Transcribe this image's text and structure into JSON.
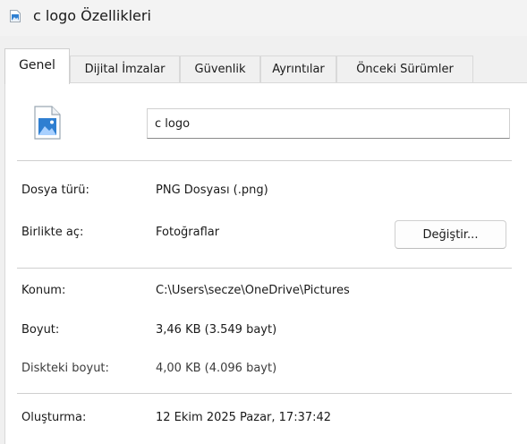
{
  "window": {
    "title": "c logo Özellikleri",
    "icon": "image-file-icon"
  },
  "tabs": [
    {
      "label": "Genel",
      "active": true
    },
    {
      "label": "Dijital İmzalar",
      "active": false
    },
    {
      "label": "Güvenlik",
      "active": false
    },
    {
      "label": "Ayrıntılar",
      "active": false
    },
    {
      "label": "Önceki Sürümler",
      "active": false
    }
  ],
  "general": {
    "file_icon": "png-image-icon",
    "file_name": "c logo",
    "type_label": "Dosya türü:",
    "type_value": "PNG Dosyası (.png)",
    "opens_with_label": "Birlikte aç:",
    "opens_with_value": "Fotoğraflar",
    "change_button": "Değiştir...",
    "location_label": "Konum:",
    "location_value": "C:\\Users\\secze\\OneDrive\\Pictures",
    "size_label": "Boyut:",
    "size_value": "3,46 KB (3.549 bayt)",
    "size_on_disk_label": "Diskteki boyut:",
    "size_on_disk_value": "4,00 KB (4.096 bayt)",
    "created_label": "Oluşturma:",
    "created_value": "12 Ekim 2025 Pazar, 17:37:42"
  },
  "colors": {
    "window_bg": "#f0f0f0",
    "panel_bg": "#ffffff",
    "icon_blue": "#2f7fd1"
  }
}
